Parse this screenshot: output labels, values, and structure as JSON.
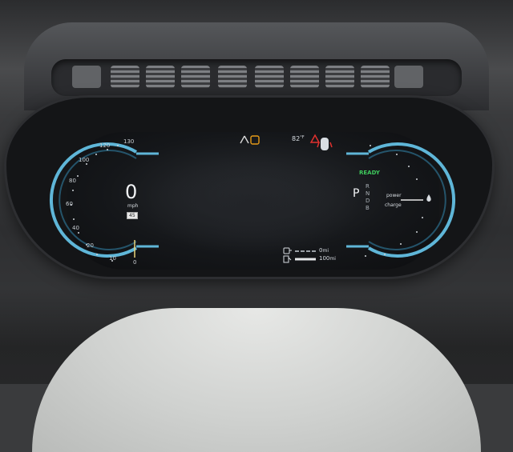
{
  "speedometer": {
    "ticks": [
      "130",
      "120",
      "100",
      "80",
      "60",
      "40",
      "20",
      "10",
      "0"
    ],
    "speed_value": "0",
    "speed_unit": "mph",
    "speed_limit": "45"
  },
  "status": {
    "outside_temp": "82",
    "temp_unit": "°F",
    "ready_label": "READY"
  },
  "gear": {
    "current": "P",
    "options": [
      "R",
      "N",
      "D",
      "B"
    ]
  },
  "power_meter": {
    "power_label": "power",
    "charge_label": "charge"
  },
  "range": {
    "electric_value": "0",
    "electric_unit": "mi",
    "fuel_value": "100",
    "fuel_unit": "mi"
  },
  "colors": {
    "ready_green": "#3ec95c",
    "warning_red": "#e0312e",
    "warning_amber": "#e59a18",
    "gauge_blue": "#5fb6d8"
  },
  "icons": {
    "road_warning": "road-departure-icon",
    "amber_light": "amber-warning-icon",
    "seatbelt": "seatbelt-warning-icon",
    "door_open": "door-open-icon",
    "plug": "ev-plug-icon",
    "fuel": "fuel-pump-icon",
    "drop": "fuel-drop-icon"
  }
}
